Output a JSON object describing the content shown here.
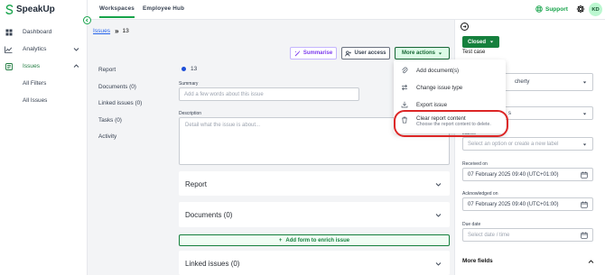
{
  "app": {
    "name": "SpeakUp"
  },
  "sidebar": {
    "items": [
      {
        "label": "Dashboard",
        "icon": "dashboard-icon"
      },
      {
        "label": "Analytics",
        "icon": "analytics-icon"
      },
      {
        "label": "Issues",
        "icon": "issues-icon"
      }
    ],
    "sub_items": [
      {
        "label": "All Filters"
      },
      {
        "label": "All Issues"
      }
    ]
  },
  "topbar": {
    "tabs": [
      {
        "label": "Workspaces"
      },
      {
        "label": "Employee Hub"
      }
    ],
    "support_label": "Support",
    "avatar_initials": "KD"
  },
  "breadcrumb": {
    "link": "Issues",
    "current": "13"
  },
  "actions": {
    "summarise": "Summarise",
    "user_access": "User access",
    "more_actions": "More actions"
  },
  "left_tabs": [
    {
      "label": "Report"
    },
    {
      "label": "Documents (0)"
    },
    {
      "label": "Linked issues (0)"
    },
    {
      "label": "Tasks (0)"
    },
    {
      "label": "Activity"
    }
  ],
  "issue": {
    "number": "13",
    "summary_label": "Summary",
    "summary_placeholder": "Add a few words about this issue",
    "description_label": "Description",
    "description_placeholder": "Detail what the issue is about..."
  },
  "sections": {
    "report": "Report",
    "documents": "Documents (0)",
    "add_form": "Add form to enrich issue",
    "linked": "Linked issues (0)"
  },
  "menu": {
    "items": [
      {
        "label": "Add document(s)",
        "icon": "paperclip-icon"
      },
      {
        "label": "Change issue type",
        "icon": "swap-icon"
      },
      {
        "label": "Export issue",
        "icon": "download-icon"
      },
      {
        "label": "Clear report content",
        "icon": "trash-icon",
        "description": "Choose the report content to delete."
      }
    ]
  },
  "right_panel": {
    "status": "Closed",
    "case_name": "Test case",
    "assignee_partial": "cherty",
    "field2_partial": "s",
    "labels_label": "Labels",
    "labels_placeholder": "Select an option or create a new label",
    "received_label": "Received on",
    "received_value": "07 February 2025 09:40 (UTC+01:00)",
    "acknowledged_label": "Acknowledged on",
    "acknowledged_value": "07 February 2025 09:40 (UTC+01:00)",
    "due_label": "Due date",
    "due_placeholder": "Select date / time",
    "more_fields": "More fields"
  },
  "colors": {
    "brand": "#16a34a",
    "highlight": "#dc2626",
    "link": "#2563eb",
    "ai": "#7c3aed"
  }
}
